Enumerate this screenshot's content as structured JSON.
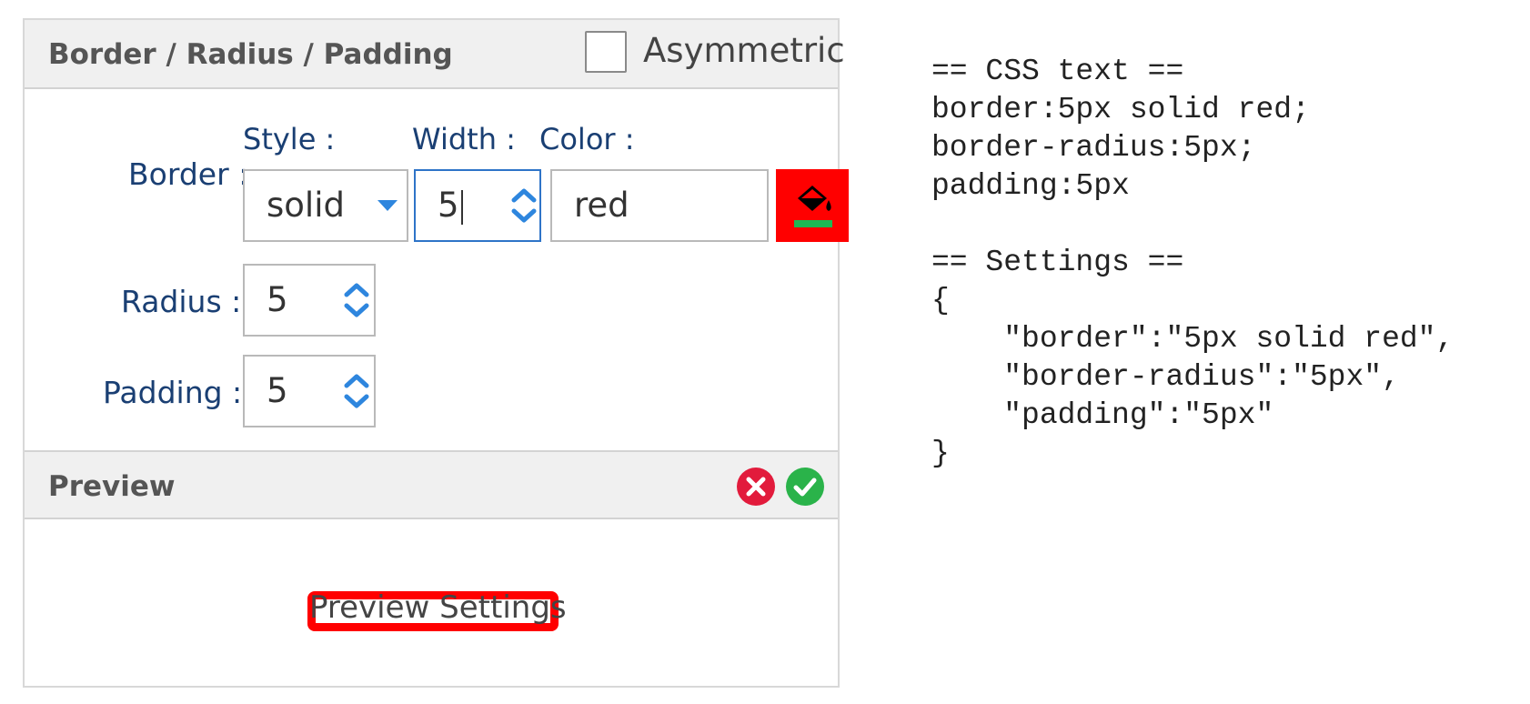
{
  "panel": {
    "title": "Border / Radius / Padding",
    "asymmetric_label": "Asymmetric",
    "asymmetric_checked": false
  },
  "border": {
    "label": "Border :",
    "style_label": "Style :",
    "style_value": "solid",
    "width_label": "Width :",
    "width_value": "5",
    "color_label": "Color :",
    "color_value": "red",
    "swatch_color": "#ff0000"
  },
  "radius": {
    "label": "Radius :",
    "value": "5"
  },
  "padding": {
    "label": "Padding :",
    "value": "5"
  },
  "preview": {
    "title": "Preview",
    "sample_text": "Preview Settings",
    "cancel_icon": "cancel-icon",
    "confirm_icon": "confirm-icon",
    "cancel_color": "#e21b3c",
    "confirm_color": "#2ab34a"
  },
  "output": {
    "css_text": "== CSS text ==\nborder:5px solid red;\nborder-radius:5px;\npadding:5px\n\n== Settings ==\n{\n    \"border\":\"5px solid red\",\n    \"border-radius\":\"5px\",\n    \"padding\":\"5px\"\n}"
  },
  "colors": {
    "label_text": "#1a3f73",
    "focus_border": "#2e74c8",
    "spinner_arrow": "#2e86de"
  }
}
